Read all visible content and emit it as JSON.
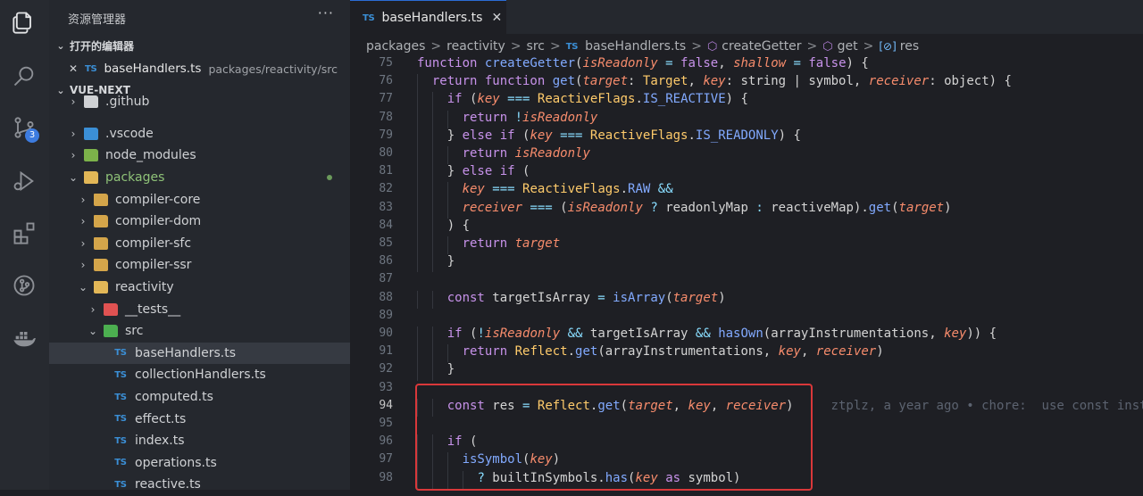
{
  "sidebar": {
    "title": "资源管理器",
    "more": "···",
    "open_editors_label": "打开的编辑器",
    "open_file": {
      "close": "✕",
      "icon": "TS",
      "name": "baseHandlers.ts",
      "path": "packages/reactivity/src"
    },
    "workspace_label": "VUE-NEXT",
    "tree": [
      {
        "label": ".github",
        "indent": 1,
        "chev": "›",
        "icon": "github"
      },
      {
        "label": ".vscode",
        "indent": 1,
        "chev": "›",
        "icon": "vscode"
      },
      {
        "label": "node_modules",
        "indent": 1,
        "chev": "›",
        "icon": "node"
      },
      {
        "label": "packages",
        "indent": 1,
        "chev": "⌄",
        "icon": "folder-open",
        "accent": true
      },
      {
        "label": "compiler-core",
        "indent": 2,
        "chev": "›",
        "icon": "folder"
      },
      {
        "label": "compiler-dom",
        "indent": 2,
        "chev": "›",
        "icon": "folder"
      },
      {
        "label": "compiler-sfc",
        "indent": 2,
        "chev": "›",
        "icon": "folder"
      },
      {
        "label": "compiler-ssr",
        "indent": 2,
        "chev": "›",
        "icon": "folder"
      },
      {
        "label": "reactivity",
        "indent": 2,
        "chev": "⌄",
        "icon": "folder-open"
      },
      {
        "label": "__tests__",
        "indent": 3,
        "chev": "›",
        "icon": "tests"
      },
      {
        "label": "src",
        "indent": 3,
        "chev": "⌄",
        "icon": "src"
      },
      {
        "label": "baseHandlers.ts",
        "indent": 4,
        "chev": "",
        "icon": "TS",
        "selected": true
      },
      {
        "label": "collectionHandlers.ts",
        "indent": 4,
        "chev": "",
        "icon": "TS"
      },
      {
        "label": "computed.ts",
        "indent": 4,
        "chev": "",
        "icon": "TS"
      },
      {
        "label": "effect.ts",
        "indent": 4,
        "chev": "",
        "icon": "TS"
      },
      {
        "label": "index.ts",
        "indent": 4,
        "chev": "",
        "icon": "TS"
      },
      {
        "label": "operations.ts",
        "indent": 4,
        "chev": "",
        "icon": "TS"
      },
      {
        "label": "reactive.ts",
        "indent": 4,
        "chev": "",
        "icon": "TS"
      }
    ]
  },
  "activity": {
    "scm_badge": "3"
  },
  "editor": {
    "tab": {
      "icon": "TS",
      "name": "baseHandlers.ts",
      "close": "✕"
    },
    "breadcrumbs": [
      "packages",
      "reactivity",
      "src",
      "baseHandlers.ts",
      "createGetter",
      "get",
      "res"
    ],
    "crumb_sep": ">",
    "file_badge": "TS",
    "current_line": 94,
    "lines": [
      {
        "n": 75,
        "indent": 0,
        "tokens": [
          [
            "kw",
            "function "
          ],
          [
            "fn",
            "createGetter"
          ],
          [
            "pl",
            "("
          ],
          [
            "pm",
            "isReadonly"
          ],
          [
            "op",
            " = "
          ],
          [
            "kw",
            "false"
          ],
          [
            "pl",
            ", "
          ],
          [
            "pm",
            "shallow"
          ],
          [
            "op",
            " = "
          ],
          [
            "kw",
            "false"
          ],
          [
            "pl",
            ") {"
          ]
        ]
      },
      {
        "n": 76,
        "indent": 1,
        "tokens": [
          [
            "kw",
            "return function "
          ],
          [
            "fn",
            "get"
          ],
          [
            "pl",
            "("
          ],
          [
            "pm",
            "target"
          ],
          [
            "pl",
            ": "
          ],
          [
            "ty",
            "Target"
          ],
          [
            "pl",
            ", "
          ],
          [
            "pm",
            "key"
          ],
          [
            "pl",
            ": string | symbol, "
          ],
          [
            "pm",
            "receiver"
          ],
          [
            "pl",
            ": object) {"
          ]
        ]
      },
      {
        "n": 77,
        "indent": 2,
        "tokens": [
          [
            "kw",
            "if "
          ],
          [
            "pl",
            "("
          ],
          [
            "pm",
            "key"
          ],
          [
            "op",
            " === "
          ],
          [
            "cls",
            "ReactiveFlags"
          ],
          [
            "pl",
            "."
          ],
          [
            "cn",
            "IS_REACTIVE"
          ],
          [
            "pl",
            ") {"
          ]
        ]
      },
      {
        "n": 78,
        "indent": 3,
        "tokens": [
          [
            "kw",
            "return "
          ],
          [
            "op",
            "!"
          ],
          [
            "pm",
            "isReadonly"
          ]
        ]
      },
      {
        "n": 79,
        "indent": 2,
        "tokens": [
          [
            "pl",
            "} "
          ],
          [
            "kw",
            "else if "
          ],
          [
            "pl",
            "("
          ],
          [
            "pm",
            "key"
          ],
          [
            "op",
            " === "
          ],
          [
            "cls",
            "ReactiveFlags"
          ],
          [
            "pl",
            "."
          ],
          [
            "cn",
            "IS_READONLY"
          ],
          [
            "pl",
            ") {"
          ]
        ]
      },
      {
        "n": 80,
        "indent": 3,
        "tokens": [
          [
            "kw",
            "return "
          ],
          [
            "pm",
            "isReadonly"
          ]
        ]
      },
      {
        "n": 81,
        "indent": 2,
        "tokens": [
          [
            "pl",
            "} "
          ],
          [
            "kw",
            "else if "
          ],
          [
            "pl",
            "("
          ]
        ]
      },
      {
        "n": 82,
        "indent": 3,
        "tokens": [
          [
            "pm",
            "key"
          ],
          [
            "op",
            " === "
          ],
          [
            "cls",
            "ReactiveFlags"
          ],
          [
            "pl",
            "."
          ],
          [
            "cn",
            "RAW"
          ],
          [
            "op",
            " &&"
          ]
        ]
      },
      {
        "n": 83,
        "indent": 3,
        "tokens": [
          [
            "pm",
            "receiver"
          ],
          [
            "op",
            " === "
          ],
          [
            "pl",
            "("
          ],
          [
            "pm",
            "isReadonly"
          ],
          [
            "op",
            " ? "
          ],
          [
            "pl",
            "readonlyMap"
          ],
          [
            "op",
            " : "
          ],
          [
            "pl",
            "reactiveMap"
          ],
          [
            "pl",
            ")."
          ],
          [
            "fn",
            "get"
          ],
          [
            "pl",
            "("
          ],
          [
            "pm",
            "target"
          ],
          [
            "pl",
            ")"
          ]
        ]
      },
      {
        "n": 84,
        "indent": 2,
        "tokens": [
          [
            "pl",
            ") {"
          ]
        ]
      },
      {
        "n": 85,
        "indent": 3,
        "tokens": [
          [
            "kw",
            "return "
          ],
          [
            "pm",
            "target"
          ]
        ]
      },
      {
        "n": 86,
        "indent": 2,
        "tokens": [
          [
            "pl",
            "}"
          ]
        ]
      },
      {
        "n": 87,
        "indent": 0,
        "tokens": []
      },
      {
        "n": 88,
        "indent": 2,
        "tokens": [
          [
            "kw",
            "const "
          ],
          [
            "pl",
            "targetIsArray"
          ],
          [
            "op",
            " = "
          ],
          [
            "fn",
            "isArray"
          ],
          [
            "pl",
            "("
          ],
          [
            "pm",
            "target"
          ],
          [
            "pl",
            ")"
          ]
        ]
      },
      {
        "n": 89,
        "indent": 0,
        "tokens": []
      },
      {
        "n": 90,
        "indent": 2,
        "tokens": [
          [
            "kw",
            "if "
          ],
          [
            "pl",
            "("
          ],
          [
            "op",
            "!"
          ],
          [
            "pm",
            "isReadonly"
          ],
          [
            "op",
            " && "
          ],
          [
            "pl",
            "targetIsArray"
          ],
          [
            "op",
            " && "
          ],
          [
            "fn",
            "hasOwn"
          ],
          [
            "pl",
            "(arrayInstrumentations, "
          ],
          [
            "pm",
            "key"
          ],
          [
            "pl",
            ")) {"
          ]
        ]
      },
      {
        "n": 91,
        "indent": 3,
        "tokens": [
          [
            "kw",
            "return "
          ],
          [
            "cls",
            "Reflect"
          ],
          [
            "pl",
            "."
          ],
          [
            "fn",
            "get"
          ],
          [
            "pl",
            "(arrayInstrumentations, "
          ],
          [
            "pm",
            "key"
          ],
          [
            "pl",
            ", "
          ],
          [
            "pm",
            "receiver"
          ],
          [
            "pl",
            ")"
          ]
        ]
      },
      {
        "n": 92,
        "indent": 2,
        "tokens": [
          [
            "pl",
            "}"
          ]
        ]
      },
      {
        "n": 93,
        "indent": 0,
        "tokens": []
      },
      {
        "n": 94,
        "indent": 2,
        "tokens": [
          [
            "kw",
            "const "
          ],
          [
            "pl",
            "res"
          ],
          [
            "op",
            " = "
          ],
          [
            "cls",
            "Reflect"
          ],
          [
            "pl",
            "."
          ],
          [
            "fn",
            "get"
          ],
          [
            "pl",
            "("
          ],
          [
            "pm",
            "target"
          ],
          [
            "pl",
            ", "
          ],
          [
            "pm",
            "key"
          ],
          [
            "pl",
            ", "
          ],
          [
            "pm",
            "receiver"
          ],
          [
            "pl",
            ")"
          ]
        ],
        "blame": "ztplz, a year ago • chore:  use const instea"
      },
      {
        "n": 95,
        "indent": 0,
        "tokens": []
      },
      {
        "n": 96,
        "indent": 2,
        "tokens": [
          [
            "kw",
            "if "
          ],
          [
            "pl",
            "("
          ]
        ]
      },
      {
        "n": 97,
        "indent": 3,
        "tokens": [
          [
            "fn",
            "isSymbol"
          ],
          [
            "pl",
            "("
          ],
          [
            "pm",
            "key"
          ],
          [
            "pl",
            ")"
          ]
        ]
      },
      {
        "n": 98,
        "indent": 4,
        "tokens": [
          [
            "op",
            "? "
          ],
          [
            "pl",
            "builtInSymbols."
          ],
          [
            "fn",
            "has"
          ],
          [
            "pl",
            "("
          ],
          [
            "pm",
            "key"
          ],
          [
            "kw",
            " as "
          ],
          [
            "pl",
            "symbol)"
          ]
        ]
      }
    ]
  },
  "colors": {
    "accent_blue": "#2b6cd4",
    "highlight_red": "#d9383a",
    "ts_blue": "#3b8fd6"
  }
}
